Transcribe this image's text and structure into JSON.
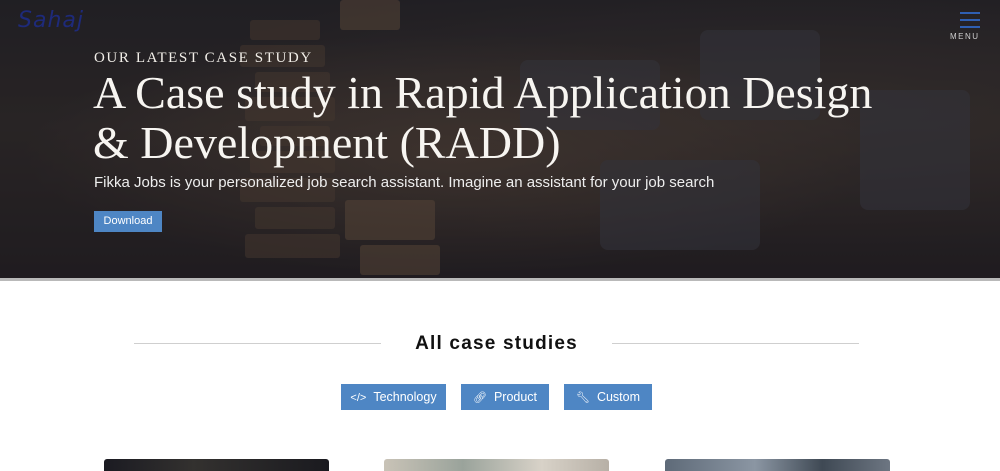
{
  "header": {
    "logo_text": "Sahaj",
    "menu_label": "MENU"
  },
  "hero": {
    "eyebrow": "OUR LATEST CASE STUDY",
    "title": "A Case study in Rapid Application Design & Development (RADD)",
    "subtitle": "Fikka Jobs is your personalized job search assistant. Imagine an assistant for your job search",
    "download_label": "Download"
  },
  "case_studies": {
    "heading": "All case studies",
    "filters": [
      {
        "label": "Technology",
        "icon": "code-icon"
      },
      {
        "label": "Product",
        "icon": "link-icon"
      },
      {
        "label": "Custom",
        "icon": "wrench-icon"
      }
    ]
  },
  "colors": {
    "accent": "#4e86c4",
    "logo": "#1e2a7a",
    "menu_icon": "#2f5fb3"
  }
}
